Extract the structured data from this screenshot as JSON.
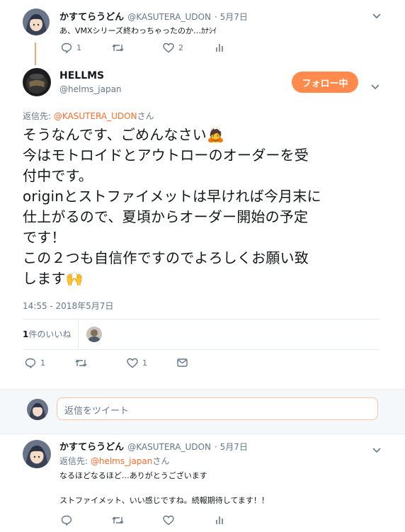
{
  "parent_tweet": {
    "name": "かすてらうどん",
    "handle": "@KASUTERA_UDON",
    "date": "· 5月7日",
    "text": "あ、VMXシリーズ終わっちゃったのか…ｶﾅｼｲ",
    "reply_count": "1",
    "like_count": "2"
  },
  "main_tweet": {
    "name": "HELLMS",
    "handle": "@helms_japan",
    "follow_label": "フォロー中",
    "reply_to_prefix": "返信先: ",
    "reply_to_handle": "@KASUTERA_UDON",
    "reply_to_suffix": "さん",
    "lines": [
      "そうなんです、ごめんなさい🙇",
      "今はモトロイドとアウトローのオーダーを受",
      "付中です。",
      "originとストファイメットは早ければ今月末に",
      "仕上がるので、夏頃からオーダー開始の予定",
      "です！",
      "この２つも自信作ですのでよろしくお願い致",
      "します🙌"
    ],
    "timestamp": "14:55 - 2018年5月7日",
    "likes_count": "1",
    "likes_label": "件のいいね",
    "reply_count": "1",
    "like_count": "1"
  },
  "reply_box": {
    "placeholder": "返信をツイート"
  },
  "reply_tweet": {
    "name": "かすてらうどん",
    "handle": "@KASUTERA_UDON",
    "date": "· 5月7日",
    "reply_to_prefix": "返信先: ",
    "reply_to_handle": "@helms_japan",
    "reply_to_suffix": "さん",
    "line1": "なるほどなるほど…ありがとうございます",
    "line2": "ストファイメット、いい感じですね。続報期待してます！！"
  },
  "colors": {
    "accent": "#ff8a4c",
    "link": "#ff6a26",
    "muted": "#657786",
    "divider": "#e6ecf0",
    "thread_line": "#f5a876"
  }
}
